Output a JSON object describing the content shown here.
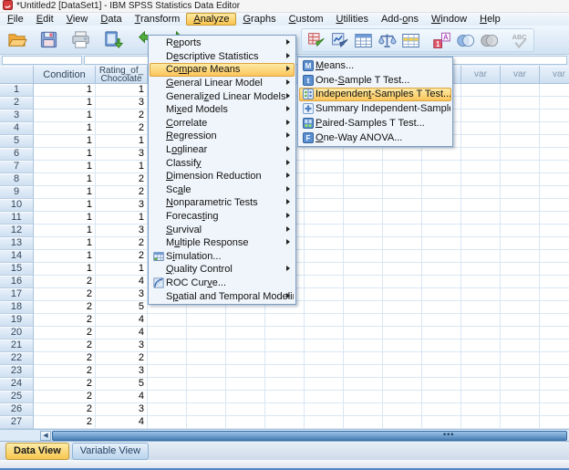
{
  "titlebar": {
    "title": "*Untitled2 [DataSet1] - IBM SPSS Statistics Data Editor",
    "app_icon": "spss-app-icon"
  },
  "menubar": {
    "active_item": "Analyze",
    "items": [
      {
        "label": "&File"
      },
      {
        "label": "&Edit"
      },
      {
        "label": "&View"
      },
      {
        "label": "&Data"
      },
      {
        "label": "&Transform"
      },
      {
        "label": "&Analyze",
        "active": true
      },
      {
        "label": "&Graphs"
      },
      {
        "label": "&Custom"
      },
      {
        "label": "&Utilities"
      },
      {
        "label": "Add-&ons"
      },
      {
        "label": "&Window"
      },
      {
        "label": "&Help"
      }
    ]
  },
  "toolbar": {
    "left_icons": [
      {
        "name": "open-data-icon"
      },
      {
        "name": "save-icon"
      },
      {
        "name": "print-icon"
      },
      {
        "name": "recall-dialogs-icon"
      },
      {
        "name": "undo-icon"
      },
      {
        "name": "redo-icon"
      }
    ],
    "right_icons": [
      {
        "name": "goto-case-icon"
      },
      {
        "name": "goto-variable-icon"
      },
      {
        "name": "variables-icon"
      },
      {
        "name": "weight-cases-icon"
      },
      {
        "name": "select-cases-icon"
      },
      {
        "name": "sep"
      },
      {
        "name": "value-labels-icon"
      },
      {
        "name": "use-variable-sets-icon"
      },
      {
        "name": "show-all-variables-icon"
      },
      {
        "name": "sep"
      },
      {
        "name": "spell-check-icon",
        "disabled": true
      }
    ]
  },
  "cell_editor": {
    "reference": "",
    "value": ""
  },
  "analyze_menu": {
    "items": [
      {
        "label": "R&eports",
        "submenu": true
      },
      {
        "label": "D&escriptive Statistics",
        "submenu": true
      },
      {
        "label": "Co&mpare Means",
        "submenu": true,
        "highlighted": true
      },
      {
        "label": "&General Linear Model",
        "submenu": true
      },
      {
        "label": "Generali&zed Linear Models",
        "submenu": true
      },
      {
        "label": "Mi&xed Models",
        "submenu": true
      },
      {
        "label": "&Correlate",
        "submenu": true
      },
      {
        "label": "&Regression",
        "submenu": true
      },
      {
        "label": "L&oglinear",
        "submenu": true
      },
      {
        "label": "Classif&y",
        "submenu": true
      },
      {
        "label": "&Dimension Reduction",
        "submenu": true
      },
      {
        "label": "Sc&ale",
        "submenu": true
      },
      {
        "label": "&Nonparametric Tests",
        "submenu": true
      },
      {
        "label": "Forecas&ting",
        "submenu": true
      },
      {
        "label": "&Survival",
        "submenu": true
      },
      {
        "label": "M&ultiple Response",
        "submenu": true
      },
      {
        "label": "S&imulation...",
        "icon": "simulation-icon"
      },
      {
        "label": "&Quality Control",
        "submenu": true
      },
      {
        "label": "ROC Cur&ve...",
        "icon": "roc-curve-icon"
      },
      {
        "label": "S&patial and Temporal Modeling...",
        "submenu": true
      }
    ]
  },
  "compare_means_submenu": {
    "items": [
      {
        "label": "&Means...",
        "icon": "means-icon"
      },
      {
        "label": "One-&Sample T Test...",
        "icon": "one-sample-t-icon"
      },
      {
        "label": "Independen&t-Samples T Test...",
        "icon": "independent-samples-t-icon",
        "highlighted": true
      },
      {
        "label": "Summary Independent-Samples T Test",
        "icon": "summary-independent-t-icon"
      },
      {
        "label": "&Paired-Samples T Test...",
        "icon": "paired-samples-t-icon"
      },
      {
        "label": "&One-Way ANOVA...",
        "icon": "one-way-anova-icon"
      }
    ]
  },
  "grid": {
    "columns": [
      "Condition",
      "Rating_of_Chocolate"
    ],
    "empty_column_label": "var",
    "empty_column_count": 11,
    "rows": [
      {
        "n": 1,
        "condition": 1,
        "rating": 1
      },
      {
        "n": 2,
        "condition": 1,
        "rating": 3
      },
      {
        "n": 3,
        "condition": 1,
        "rating": 2
      },
      {
        "n": 4,
        "condition": 1,
        "rating": 2
      },
      {
        "n": 5,
        "condition": 1,
        "rating": 1
      },
      {
        "n": 6,
        "condition": 1,
        "rating": 3
      },
      {
        "n": 7,
        "condition": 1,
        "rating": 1
      },
      {
        "n": 8,
        "condition": 1,
        "rating": 2
      },
      {
        "n": 9,
        "condition": 1,
        "rating": 2
      },
      {
        "n": 10,
        "condition": 1,
        "rating": 3
      },
      {
        "n": 11,
        "condition": 1,
        "rating": 1
      },
      {
        "n": 12,
        "condition": 1,
        "rating": 3
      },
      {
        "n": 13,
        "condition": 1,
        "rating": 2
      },
      {
        "n": 14,
        "condition": 1,
        "rating": 2
      },
      {
        "n": 15,
        "condition": 1,
        "rating": 1
      },
      {
        "n": 16,
        "condition": 2,
        "rating": 4
      },
      {
        "n": 17,
        "condition": 2,
        "rating": 3
      },
      {
        "n": 18,
        "condition": 2,
        "rating": 5
      },
      {
        "n": 19,
        "condition": 2,
        "rating": 4
      },
      {
        "n": 20,
        "condition": 2,
        "rating": 4
      },
      {
        "n": 21,
        "condition": 2,
        "rating": 3
      },
      {
        "n": 22,
        "condition": 2,
        "rating": 2
      },
      {
        "n": 23,
        "condition": 2,
        "rating": 3
      },
      {
        "n": 24,
        "condition": 2,
        "rating": 5
      },
      {
        "n": 25,
        "condition": 2,
        "rating": 4
      },
      {
        "n": 26,
        "condition": 2,
        "rating": 3
      },
      {
        "n": 27,
        "condition": 2,
        "rating": 4
      }
    ]
  },
  "view_tabs": {
    "items": [
      {
        "label": "Data View",
        "active": true
      },
      {
        "label": "Variable View",
        "active": false
      }
    ]
  },
  "colors": {
    "selection_highlight_top": "#fdeaa5",
    "selection_highlight_bottom": "#fbc55a",
    "menu_background": "#f0f5fb",
    "menu_border": "#7da0c7",
    "grid_line": "#d9e6f3",
    "header_gradient_top": "#eaf2fb",
    "header_gradient_bottom": "#cfe0f1",
    "header_text": "#33475c",
    "var_header_text": "#8296ac",
    "scrollbar_thumb": "#4a7fb5",
    "bottom_strip": "#4f86c6"
  }
}
